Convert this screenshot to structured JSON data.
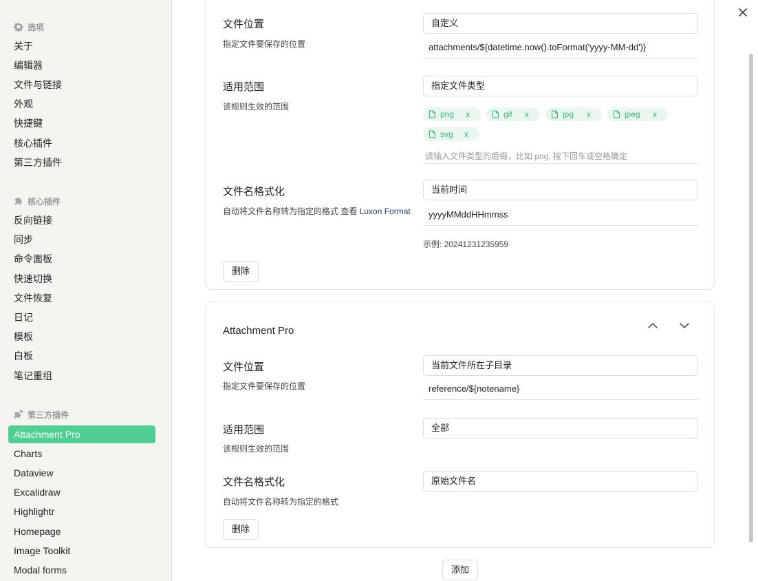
{
  "sidebar": {
    "options_header": "选项",
    "options_items": [
      "关于",
      "编辑器",
      "文件与链接",
      "外观",
      "快捷键",
      "核心插件",
      "第三方插件"
    ],
    "core_header": "核心插件",
    "core_items": [
      "反向链接",
      "同步",
      "命令面板",
      "快速切换",
      "文件恢复",
      "日记",
      "模板",
      "白板",
      "笔记重组"
    ],
    "third_header": "第三方插件",
    "third_items": [
      "Attachment Pro",
      "Charts",
      "Dataview",
      "Excalidraw",
      "Highlightr",
      "Homepage",
      "Image Toolkit",
      "Modal forms"
    ],
    "active_item": "Attachment Pro"
  },
  "card1": {
    "location": {
      "title": "文件位置",
      "desc": "指定文件要保存的位置",
      "select_value": "自定义",
      "path_value": "attachments/${datetime.now().toFormat('yyyy-MM-dd')}"
    },
    "scope": {
      "title": "适用范围",
      "desc": "该规则生效的范围",
      "select_value": "指定文件类型",
      "tags": [
        "png",
        "gif",
        "jpg",
        "jpeg",
        "svg"
      ],
      "tag_remove": "x",
      "input_placeholder": "请输入文件类型的后缀，比如 png. 按下回车或空格确定"
    },
    "naming": {
      "title": "文件名格式化",
      "desc_prefix": "自动将文件名称转为指定的格式 查看 ",
      "desc_link": "Luxon Format",
      "select_value": "当前时间",
      "format_value": "yyyyMMddHHmmss",
      "example": "示例: 20241231235959"
    },
    "delete_label": "删除"
  },
  "card2": {
    "name": "Attachment Pro",
    "location": {
      "title": "文件位置",
      "desc": "指定文件要保存的位置",
      "select_value": "当前文件所在子目录",
      "path_value": "reference/${notename}"
    },
    "scope": {
      "title": "适用范围",
      "desc": "该规则生效的范围",
      "select_value": "全部"
    },
    "naming": {
      "title": "文件名格式化",
      "desc": "自动将文件名称转为指定的格式",
      "select_value": "原始文件名"
    },
    "delete_label": "删除"
  },
  "add_label": "添加",
  "colors": {
    "accent": "#4fcf94",
    "tag_bg": "#e9f7ef",
    "tag_text": "#39b572",
    "sidebar_bg": "#f6f4f0"
  }
}
